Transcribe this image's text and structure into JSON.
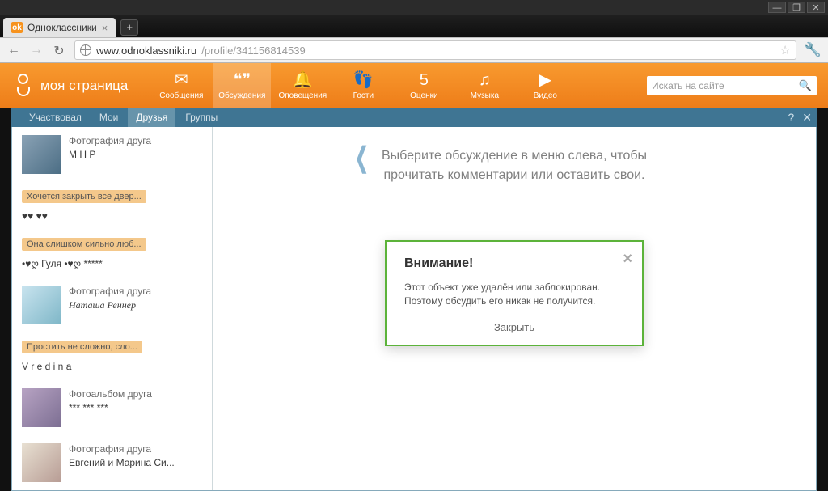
{
  "window": {
    "minimize": "—",
    "maximize": "❐",
    "close": "✕"
  },
  "browser": {
    "tab_title": "Одноклассники",
    "tab_close": "×",
    "newtab": "+",
    "back": "←",
    "forward": "→",
    "reload": "↻",
    "url_host": "www.odnoklassniki.ru",
    "url_path": "/profile/341156814539",
    "star": "☆",
    "wrench": "🔧"
  },
  "header": {
    "brand": "моя страница",
    "nav": [
      {
        "label": "Сообщения",
        "icon": "✉"
      },
      {
        "label": "Обсуждения",
        "icon": "❝❞",
        "active": true
      },
      {
        "label": "Оповещения",
        "icon": "🔔"
      },
      {
        "label": "Гости",
        "icon": "👣"
      },
      {
        "label": "Оценки",
        "icon": "5"
      },
      {
        "label": "Музыка",
        "icon": "♫"
      },
      {
        "label": "Видео",
        "icon": "▶"
      }
    ],
    "search_placeholder": "Искать на сайте",
    "search_icon": "🔍"
  },
  "disc_tabs": {
    "items": [
      "Участвовал",
      "Мои",
      "Друзья",
      "Группы"
    ],
    "active_index": 2,
    "help": "?",
    "close": "✕"
  },
  "feed": [
    {
      "thumb": "a",
      "title": "Фотография друга",
      "name": "М Н Р"
    },
    {
      "chip": "Хочется закрыть все двер...",
      "name": "♥♥ ♥♥"
    },
    {
      "chip": "Она слишком сильно люб...",
      "name": "•♥ღ Гуля •♥ღ *****"
    },
    {
      "thumb": "b",
      "title": "Фотография друга",
      "name": "Наташа Реннер",
      "fancy": true
    },
    {
      "chip": "Простить не сложно, сло...",
      "name": "V r e d i n a"
    },
    {
      "thumb": "c",
      "title": "Фотоальбом друга",
      "name": "*** *** ***"
    },
    {
      "thumb": "d",
      "title": "Фотография друга",
      "name": "Евгений и Марина Си..."
    }
  ],
  "hint": {
    "line1": "Выберите обсуждение в меню слева, чтобы",
    "line2": "прочитать комментарии или оставить свои.",
    "chev": "❮"
  },
  "modal": {
    "title": "Внимание!",
    "body1": "Этот объект уже удалён или заблокирован.",
    "body2": "Поэтому обсудить его никак не получится.",
    "close_btn": "Закрыть",
    "x": "×"
  }
}
